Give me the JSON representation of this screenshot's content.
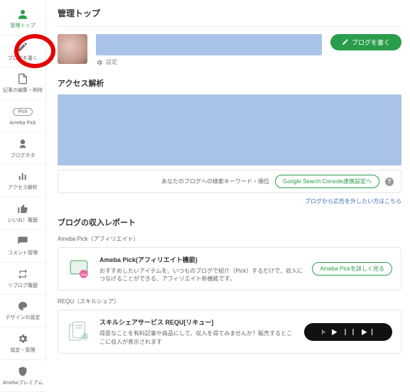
{
  "page_title": "管理トップ",
  "sidebar": {
    "items": [
      {
        "label": "管理トップ",
        "name": "sidebar-item-dashboard"
      },
      {
        "label": "ブログを書く",
        "name": "sidebar-item-write-blog"
      },
      {
        "label": "記事の編集・削除",
        "name": "sidebar-item-edit-articles"
      },
      {
        "label": "Ameba Pick",
        "name": "sidebar-item-ameba-pick",
        "badge": "Pick"
      },
      {
        "label": "ブログネタ",
        "name": "sidebar-item-blog-topics"
      },
      {
        "label": "アクセス解析",
        "name": "sidebar-item-analytics"
      },
      {
        "label": "いいね！履歴",
        "name": "sidebar-item-likes"
      },
      {
        "label": "コメント管理",
        "name": "sidebar-item-comments"
      },
      {
        "label": "リブログ履歴",
        "name": "sidebar-item-reblog"
      },
      {
        "label": "デザインの設定",
        "name": "sidebar-item-design"
      },
      {
        "label": "設定・管理",
        "name": "sidebar-item-settings"
      },
      {
        "label": "Amebaプレミアム",
        "name": "sidebar-item-premium"
      }
    ]
  },
  "profile": {
    "settings_label": "設定",
    "write_button": "ブログを書く"
  },
  "access": {
    "section_title": "アクセス解析",
    "keyword_text": "あなたのブログへの検索キーワード・順位",
    "gsc_button": "Google Search Console連携設定へ",
    "ad_link": "ブログから広告を外したい方はこちら"
  },
  "revenue": {
    "section_title": "ブログの収入レポート",
    "pick": {
      "sub_label": "Ameba Pick（アフィリエイト）",
      "card_title": "Ameba Pick(アフィリエイト機能)",
      "card_desc": "おすすめしたいアイテムを、いつものブログで紹介（Pick）するだけで、収入につなげることができる、アフィリエイト新機能です。",
      "button": "Ameba Pickを詳しく見る"
    },
    "requ": {
      "sub_label": "REQU（スキルシェア）",
      "card_title": "スキルシェアサービス REQU[リキュー]",
      "card_desc": "得意なことを有料記事や商品にして、収入を得てみませんか？販売するとここに収入が表示されます",
      "button": "ト ▶ ┃┃ ▶┃"
    }
  }
}
